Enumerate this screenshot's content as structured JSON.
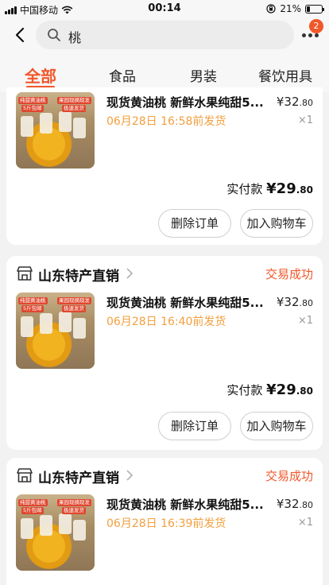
{
  "status_bar": {
    "carrier": "中国移动",
    "time": "00:14",
    "battery": "21%",
    "battery_level": 0.21
  },
  "search": {
    "query": "桃",
    "notification_count": "2"
  },
  "tabs": [
    {
      "label": "全部",
      "active": true
    },
    {
      "label": "食品",
      "active": false
    },
    {
      "label": "男装",
      "active": false
    },
    {
      "label": "餐饮用具",
      "active": false
    }
  ],
  "product": {
    "image_tag_1": "纯甜黄油桃",
    "image_tag_2": "果园现摘现发",
    "image_tag_3": "5斤包邮",
    "image_tag_4": "极速发货"
  },
  "orders": [
    {
      "shop": "",
      "status": "",
      "title": "现货黄油桃 新鲜水果纯甜5...",
      "price_yuan": "¥32",
      "price_cents": ".80",
      "ship_time": "06月28日 16:58前发货",
      "qty": "×1",
      "paid_label": "实付款",
      "paid_yuan": "¥29",
      "paid_cents": ".80",
      "btn_delete": "删除订单",
      "btn_cart": "加入购物车"
    },
    {
      "shop": "山东特产直销",
      "status": "交易成功",
      "title": "现货黄油桃 新鲜水果纯甜5...",
      "price_yuan": "¥32",
      "price_cents": ".80",
      "ship_time": "06月28日 16:40前发货",
      "qty": "×1",
      "paid_label": "实付款",
      "paid_yuan": "¥29",
      "paid_cents": ".80",
      "btn_delete": "删除订单",
      "btn_cart": "加入购物车"
    },
    {
      "shop": "山东特产直销",
      "status": "交易成功",
      "title": "现货黄油桃 新鲜水果纯甜5...",
      "price_yuan": "¥32",
      "price_cents": ".80",
      "ship_time": "06月28日 16:39前发货",
      "qty": "×1"
    }
  ],
  "colors": {
    "accent": "#f2572a",
    "ship_text": "#f2a03f",
    "background": "#f2f2f2"
  },
  "icons": [
    "back-arrow-icon",
    "search-icon",
    "more-dots-icon",
    "store-icon",
    "chevron-right-icon",
    "wifi-icon",
    "signal-icon",
    "battery-icon",
    "lock-rotation-icon"
  ]
}
